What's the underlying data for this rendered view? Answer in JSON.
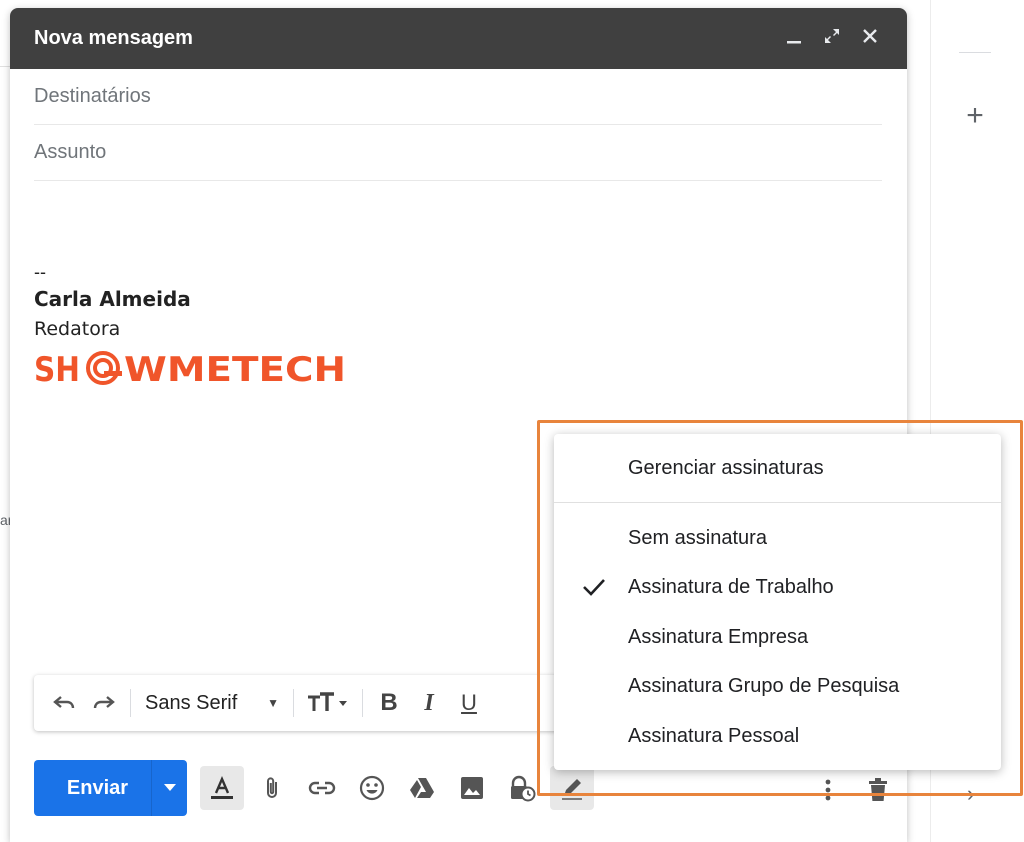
{
  "compose": {
    "title": "Nova mensagem",
    "to_placeholder": "Destinatários",
    "subject_placeholder": "Assunto"
  },
  "signature": {
    "dash": "--",
    "name": "Carla Almeida",
    "role": "Redatora",
    "logo_text": "SHOWMETECH",
    "logo_color": "#f0552a"
  },
  "toolbar": {
    "font_name": "Sans Serif"
  },
  "actions": {
    "send_label": "Enviar",
    "send_color": "#1a73e8"
  },
  "signature_menu": {
    "manage": "Gerenciar assinaturas",
    "items": [
      {
        "label": "Sem assinatura",
        "checked": false
      },
      {
        "label": "Assinatura de Trabalho",
        "checked": true
      },
      {
        "label": "Assinatura Empresa",
        "checked": false
      },
      {
        "label": "Assinatura Grupo de Pesquisa",
        "checked": false
      },
      {
        "label": "Assinatura Pessoal",
        "checked": false
      }
    ]
  },
  "highlight_color": "#e8843c"
}
